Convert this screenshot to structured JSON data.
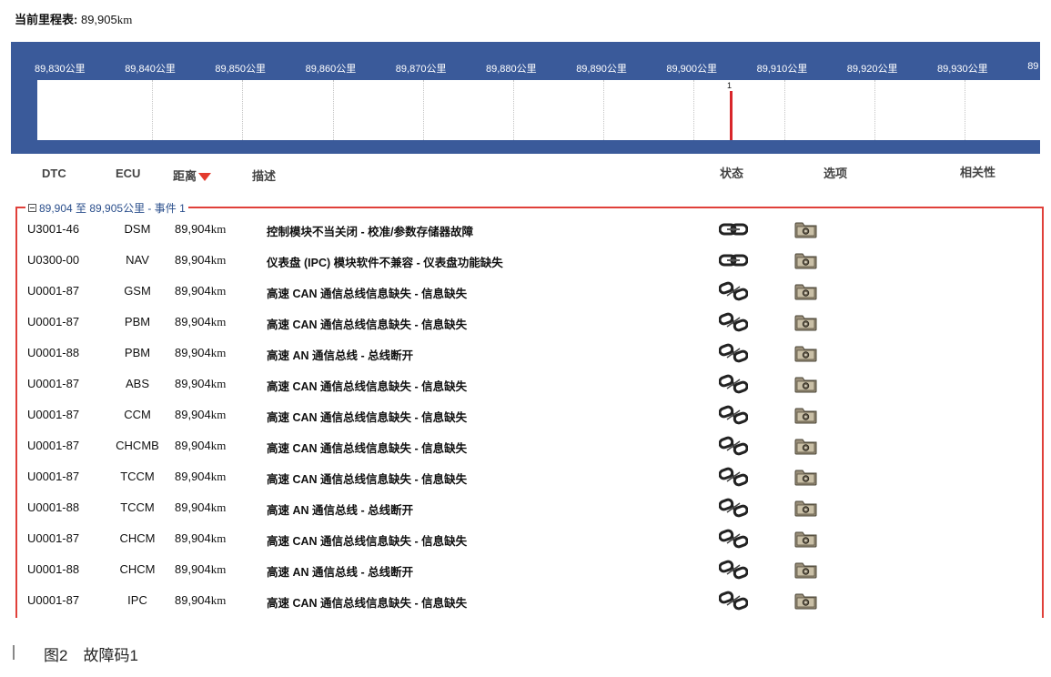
{
  "odometer": {
    "label": "当前里程表:",
    "value": "89,905",
    "unit": "km"
  },
  "timeline": {
    "ticks": [
      "89,830公里",
      "89,840公里",
      "89,850公里",
      "89,860公里",
      "89,870公里",
      "89,880公里",
      "89,890公里",
      "89,900公里",
      "89,910公里",
      "89,920公里",
      "89,930公里",
      "89"
    ],
    "event_count": "1"
  },
  "columns": {
    "dtc": "DTC",
    "ecu": "ECU",
    "distance": "距离",
    "description": "描述",
    "status": "状态",
    "options": "选项",
    "relevance": "相关性"
  },
  "group": {
    "range": "89,904 至 89,905公里 - 事件 1"
  },
  "rows": [
    {
      "dtc": "U3001-46",
      "ecu": "DSM",
      "dist": "89,904",
      "unit": "km",
      "desc": "控制模块不当关闭 - 校准/参数存储器故障",
      "status": "link-connected-icon"
    },
    {
      "dtc": "U0300-00",
      "ecu": "NAV",
      "dist": "89,904",
      "unit": "km",
      "desc": "仪表盘 (IPC) 模块软件不兼容 - 仪表盘功能缺失",
      "status": "link-connected-icon"
    },
    {
      "dtc": "U0001-87",
      "ecu": "GSM",
      "dist": "89,904",
      "unit": "km",
      "desc": "高速 CAN 通信总线信息缺失 - 信息缺失",
      "status": "link-broken-icon"
    },
    {
      "dtc": "U0001-87",
      "ecu": "PBM",
      "dist": "89,904",
      "unit": "km",
      "desc": "高速 CAN 通信总线信息缺失 - 信息缺失",
      "status": "link-broken-icon"
    },
    {
      "dtc": "U0001-88",
      "ecu": "PBM",
      "dist": "89,904",
      "unit": "km",
      "desc": "高速 AN 通信总线 - 总线断开",
      "status": "link-broken-icon"
    },
    {
      "dtc": "U0001-87",
      "ecu": "ABS",
      "dist": "89,904",
      "unit": "km",
      "desc": "高速 CAN 通信总线信息缺失 - 信息缺失",
      "status": "link-broken-icon"
    },
    {
      "dtc": "U0001-87",
      "ecu": "CCM",
      "dist": "89,904",
      "unit": "km",
      "desc": "高速 CAN 通信总线信息缺失 - 信息缺失",
      "status": "link-broken-icon"
    },
    {
      "dtc": "U0001-87",
      "ecu": "CHCMB",
      "dist": "89,904",
      "unit": "km",
      "desc": "高速 CAN 通信总线信息缺失 - 信息缺失",
      "status": "link-broken-icon"
    },
    {
      "dtc": "U0001-87",
      "ecu": "TCCM",
      "dist": "89,904",
      "unit": "km",
      "desc": "高速 CAN 通信总线信息缺失 - 信息缺失",
      "status": "link-broken-icon"
    },
    {
      "dtc": "U0001-88",
      "ecu": "TCCM",
      "dist": "89,904",
      "unit": "km",
      "desc": "高速 AN 通信总线 - 总线断开",
      "status": "link-broken-icon"
    },
    {
      "dtc": "U0001-87",
      "ecu": "CHCM",
      "dist": "89,904",
      "unit": "km",
      "desc": "高速 CAN 通信总线信息缺失 - 信息缺失",
      "status": "link-broken-icon"
    },
    {
      "dtc": "U0001-88",
      "ecu": "CHCM",
      "dist": "89,904",
      "unit": "km",
      "desc": "高速 AN 通信总线 - 总线断开",
      "status": "link-broken-icon"
    },
    {
      "dtc": "U0001-87",
      "ecu": "IPC",
      "dist": "89,904",
      "unit": "km",
      "desc": "高速 CAN 通信总线信息缺失 - 信息缺失",
      "status": "link-broken-icon"
    }
  ],
  "option_icon": "camera-folder-icon",
  "caption": "图2　故障码1",
  "colors": {
    "timeline_bg": "#3a5a9a",
    "marker": "#d8262b",
    "group_frame": "#e0403a",
    "group_text": "#2b4f8c"
  }
}
